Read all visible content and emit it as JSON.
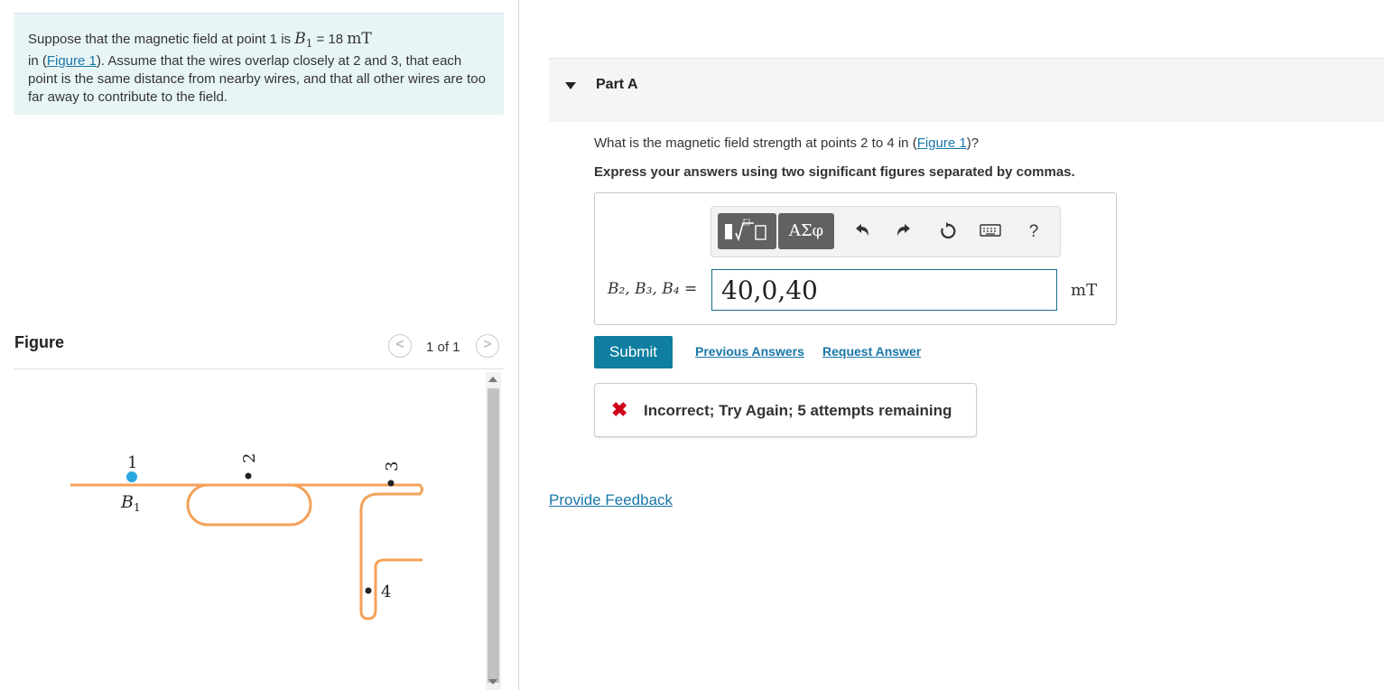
{
  "problem": {
    "text_before": "Suppose that the magnetic field at point 1 is ",
    "b1_symbol": "B",
    "b1_sub": "1",
    "b1_equals": " = 18 ",
    "b1_unit": "mT",
    "text_in": " in (",
    "figure_link": "Figure 1",
    "text_after": "). Assume that the wires overlap closely at 2 and 3, that each point is the same distance from nearby wires, and that all other wires are too far away to contribute to the field."
  },
  "figure_panel": {
    "heading": "Figure",
    "prev_icon": "chevron-left-icon",
    "next_icon": "chevron-right-icon",
    "prev_label": "<",
    "next_label": ">",
    "count": "1 of 1",
    "labels": {
      "p1": "1",
      "p2": "2",
      "p3": "3",
      "p4": "4",
      "b": "B",
      "b_sub": "1"
    },
    "colors": {
      "wire": "#f4a25a",
      "point1": "#29a8e0",
      "points": "#222222"
    }
  },
  "part": {
    "title": "Part A",
    "question_before": "What is the magnetic field strength at points 2 to 4 in (",
    "question_link": "Figure 1",
    "question_after": ")?",
    "instructions": "Express your answers using two significant figures separated by commas."
  },
  "toolbar": {
    "templates_icon": "templates-icon",
    "symbols_label": "ΑΣφ",
    "undo_icon": "undo-icon",
    "redo_icon": "redo-icon",
    "reset_icon": "reset-icon",
    "keyboard_icon": "keyboard-icon",
    "help_label": "?"
  },
  "answer": {
    "label": "B₂, B₃, B₄ =",
    "value": "40,0,40",
    "unit": "mT"
  },
  "actions": {
    "submit": "Submit",
    "previous_answers": "Previous Answers",
    "request_answer": "Request Answer"
  },
  "feedback": {
    "icon": "x-icon",
    "symbol": "✖",
    "text": "Incorrect; Try Again; 5 attempts remaining"
  },
  "provide_feedback": "Provide Feedback",
  "colors": {
    "accent": "#0f7ea0",
    "link": "#1a77a8",
    "error": "#d0021b",
    "problem_bg": "#e8f5f6"
  }
}
